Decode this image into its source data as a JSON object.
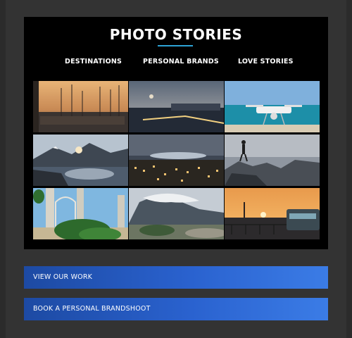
{
  "header": {
    "title": "PHOTO STORIES"
  },
  "nav": {
    "items": [
      {
        "label": "DESTINATIONS"
      },
      {
        "label": "PERSONAL BRANDS"
      },
      {
        "label": "LOVE STORIES"
      }
    ]
  },
  "gallery": {
    "photos": [
      {
        "icon": "harbor-sunset-photo"
      },
      {
        "icon": "city-waterfront-dusk-photo"
      },
      {
        "icon": "drone-over-beach-photo"
      },
      {
        "icon": "mountain-lake-photo"
      },
      {
        "icon": "city-at-night-photo"
      },
      {
        "icon": "hiker-on-rocks-photo"
      },
      {
        "icon": "tropical-gate-photo"
      },
      {
        "icon": "cloudy-mountain-town-photo"
      },
      {
        "icon": "sunset-pier-photo"
      }
    ]
  },
  "actions": {
    "view_work": "VIEW OUR WORK",
    "book_shoot": "BOOK A PERSONAL BRANDSHOOT"
  },
  "colors": {
    "page_background": "#333333",
    "panel_background": "#000000",
    "accent_underline": "#2ea3d6",
    "button_gradient_start": "#1d4aa3",
    "button_gradient_end": "#3b7ce6"
  }
}
